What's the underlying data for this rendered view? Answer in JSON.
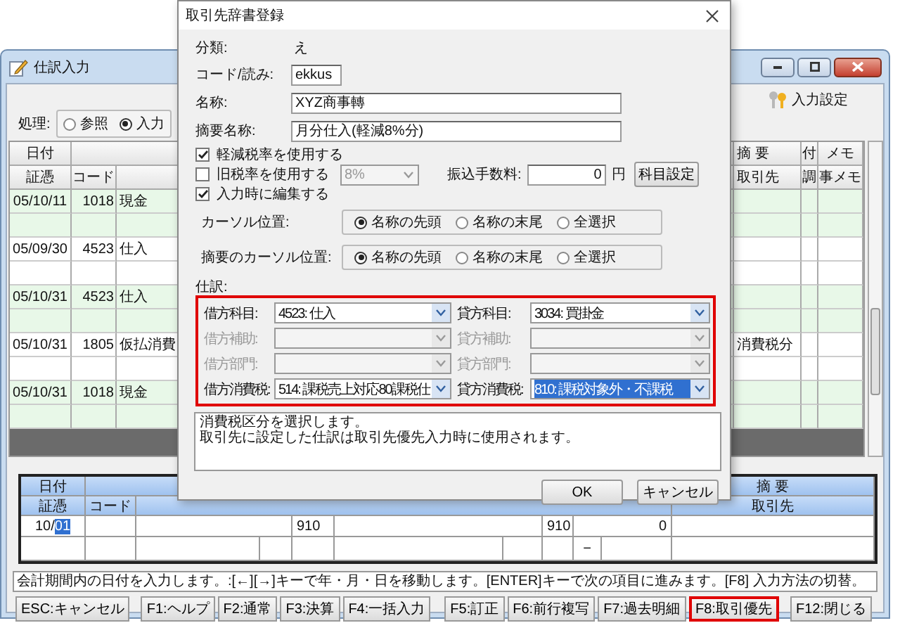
{
  "main_window": {
    "title": "仕訳入力",
    "settings_button": "入力設定",
    "mode": {
      "label": "処理:",
      "options": [
        {
          "label": "参照",
          "selected": false
        },
        {
          "label": "入力",
          "selected": true
        }
      ]
    },
    "table": {
      "header_row1": {
        "date": "日付",
        "summary": "摘 要",
        "attach": "付",
        "memo": "メモ"
      },
      "header_row2": {
        "voucher": "証憑",
        "code": "コード",
        "partner": "取引先",
        "adjust": "調",
        "memo": "事メモ"
      },
      "rows": [
        {
          "date": "05/10/11",
          "code": "1018",
          "account": "現金",
          "summary": ""
        },
        {
          "date": "05/09/30",
          "code": "4523",
          "account": "仕入",
          "summary": ""
        },
        {
          "date": "05/10/31",
          "code": "4523",
          "account": "仕入",
          "summary": ""
        },
        {
          "date": "05/10/31",
          "code": "1805",
          "account": "仮払消費",
          "summary": "消費税分"
        },
        {
          "date": "05/10/31",
          "code": "1018",
          "account": "現金",
          "summary": ""
        }
      ]
    },
    "entry": {
      "header_row1": {
        "date": "日付",
        "summary": "摘 要"
      },
      "header_row2": {
        "voucher": "証憑",
        "code": "コード",
        "partner": "取引先"
      },
      "date_prefix": "10/",
      "date_selected": "01",
      "debit_tax": "910",
      "credit_tax": "910",
      "amount": "0",
      "dash": "−"
    },
    "status": "会計期間内の日付を入力します。:[←][→]キーで年・月・日を移動します。[ENTER]キーで次の項目に進みます。[F8] 入力方法の切替。",
    "function_keys": [
      {
        "label": "ESC:キャンセル",
        "highlighted": false
      },
      {
        "label": "F1:ヘルプ",
        "highlighted": false
      },
      {
        "label": "F2:通常",
        "highlighted": false
      },
      {
        "label": "F3:決算",
        "highlighted": false
      },
      {
        "label": "F4:一括入力",
        "highlighted": false
      },
      {
        "label": "F5:訂正",
        "highlighted": false
      },
      {
        "label": "F6:前行複写",
        "highlighted": false
      },
      {
        "label": "F7:過去明細",
        "highlighted": false
      },
      {
        "label": "F8:取引優先",
        "highlighted": true
      },
      {
        "label": "F12:閉じる",
        "highlighted": false
      }
    ]
  },
  "dialog": {
    "title": "取引先辞書登録",
    "category": {
      "label": "分類:",
      "value": "え"
    },
    "code": {
      "label": "コード/読み:",
      "value": "ekkus"
    },
    "name": {
      "label": "名称:",
      "value": "XYZ商事轉"
    },
    "summary_name": {
      "label": "摘要名称:",
      "value": "月分仕入(軽減8%分)"
    },
    "reduced_rate": {
      "label": "軽減税率を使用する",
      "checked": true
    },
    "old_rate": {
      "label": "旧税率を使用する",
      "checked": false,
      "rate": "8%"
    },
    "transfer_fee": {
      "label": "振込手数料:",
      "value": "0",
      "unit": "円"
    },
    "account_settings_button": "科目設定",
    "edit_on_input": {
      "label": "入力時に編集する",
      "checked": true
    },
    "cursor_groups": [
      {
        "label": "カーソル位置:",
        "options": [
          {
            "label": "名称の先頭",
            "selected": true
          },
          {
            "label": "名称の末尾",
            "selected": false
          },
          {
            "label": "全選択",
            "selected": false
          }
        ]
      },
      {
        "label": "摘要のカーソル位置:",
        "options": [
          {
            "label": "名称の先頭",
            "selected": true
          },
          {
            "label": "名称の末尾",
            "selected": false
          },
          {
            "label": "全選択",
            "selected": false
          }
        ]
      }
    ],
    "journal": {
      "label": "仕訳:",
      "highlighted": true,
      "fields": [
        {
          "label": "借方科目:",
          "value": "4523: 仕入",
          "disabled": false,
          "focused": false
        },
        {
          "label": "貸方科目:",
          "value": "3034: 買掛金",
          "disabled": false,
          "focused": false
        },
        {
          "label": "借方補助:",
          "disabled": true,
          "focused": false
        },
        {
          "label": "貸方補助:",
          "disabled": true,
          "focused": false
        },
        {
          "label": "借方部門:",
          "disabled": true,
          "focused": false
        },
        {
          "label": "貸方部門:",
          "disabled": true,
          "focused": false
        },
        {
          "label": "借方消費税:",
          "value": "514: 課税売上対応80課税仕",
          "disabled": false,
          "focused": false
        },
        {
          "label": "貸方消費税:",
          "value": "810: 課税対象外・不課税",
          "disabled": false,
          "focused": true
        }
      ]
    },
    "description": [
      "消費税区分を選択します。",
      "取引先に設定した仕訳は取引先優先入力時に使用されます。"
    ],
    "ok_button": "OK",
    "cancel_button": "キャンセル"
  }
}
